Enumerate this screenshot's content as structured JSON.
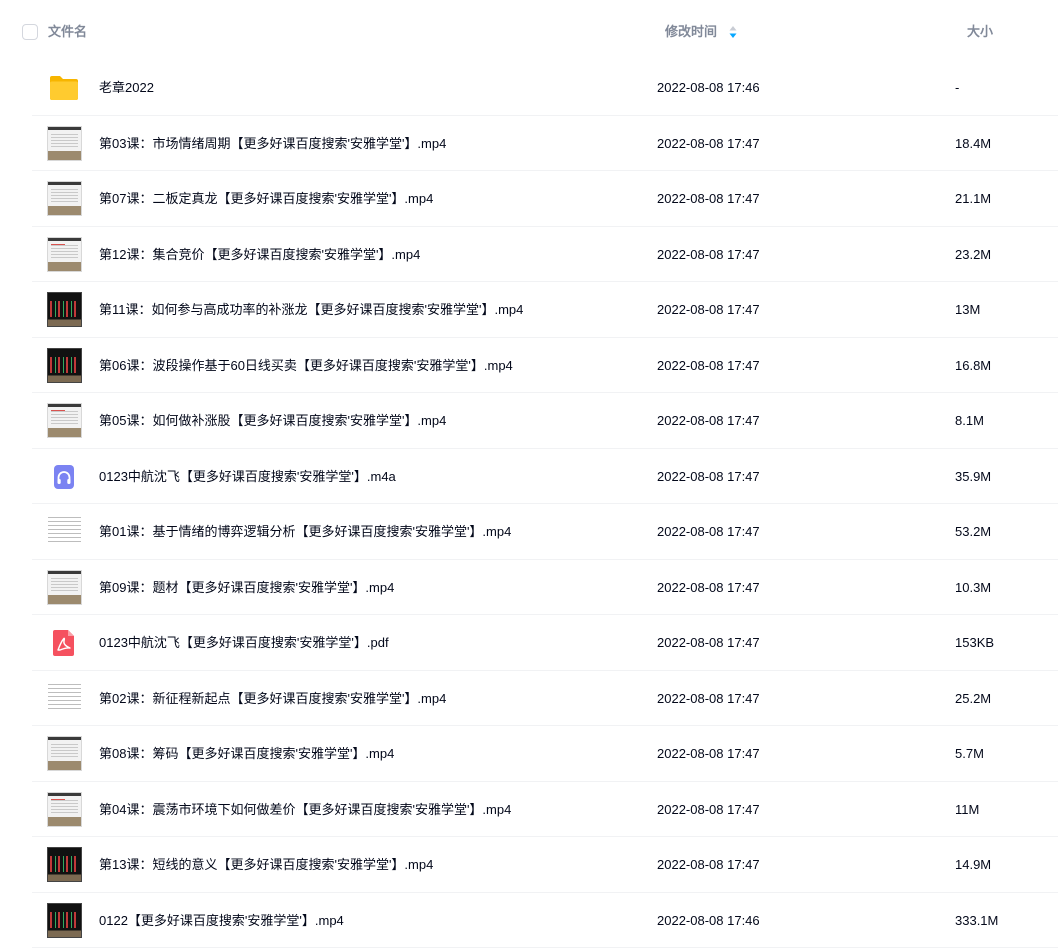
{
  "header": {
    "name_label": "文件名",
    "time_label": "修改时间",
    "size_label": "大小"
  },
  "files": [
    {
      "name": "老章2022",
      "time": "2022-08-08 17:46",
      "size": "-",
      "icon": "folder-icon"
    },
    {
      "name": "第03课：市场情绪周期【更多好课百度搜索'安雅学堂'】.mp4",
      "time": "2022-08-08 17:47",
      "size": "18.4M",
      "icon": "video-thumbnail"
    },
    {
      "name": "第07课：二板定真龙【更多好课百度搜索'安雅学堂'】.mp4",
      "time": "2022-08-08 17:47",
      "size": "21.1M",
      "icon": "video-thumbnail"
    },
    {
      "name": "第12课：集合竞价【更多好课百度搜索'安雅学堂'】.mp4",
      "time": "2022-08-08 17:47",
      "size": "23.2M",
      "icon": "video-thumbnail"
    },
    {
      "name": "第11课：如何参与高成功率的补涨龙【更多好课百度搜索'安雅学堂'】.mp4",
      "time": "2022-08-08 17:47",
      "size": "13M",
      "icon": "video-thumbnail"
    },
    {
      "name": "第06课：波段操作基于60日线买卖【更多好课百度搜索'安雅学堂'】.mp4",
      "time": "2022-08-08 17:47",
      "size": "16.8M",
      "icon": "video-thumbnail"
    },
    {
      "name": "第05课：如何做补涨股【更多好课百度搜索'安雅学堂'】.mp4",
      "time": "2022-08-08 17:47",
      "size": "8.1M",
      "icon": "video-thumbnail"
    },
    {
      "name": "0123中航沈飞【更多好课百度搜索'安雅学堂'】.m4a",
      "time": "2022-08-08 17:47",
      "size": "35.9M",
      "icon": "audio-icon"
    },
    {
      "name": "第01课：基于情绪的博弈逻辑分析【更多好课百度搜索'安雅学堂'】.mp4",
      "time": "2022-08-08 17:47",
      "size": "53.2M",
      "icon": "video-thumbnail"
    },
    {
      "name": "第09课：题材【更多好课百度搜索'安雅学堂'】.mp4",
      "time": "2022-08-08 17:47",
      "size": "10.3M",
      "icon": "video-thumbnail"
    },
    {
      "name": "0123中航沈飞【更多好课百度搜索'安雅学堂'】.pdf",
      "time": "2022-08-08 17:47",
      "size": "153KB",
      "icon": "pdf-icon"
    },
    {
      "name": "第02课：新征程新起点【更多好课百度搜索'安雅学堂'】.mp4",
      "time": "2022-08-08 17:47",
      "size": "25.2M",
      "icon": "video-thumbnail"
    },
    {
      "name": "第08课：筹码【更多好课百度搜索'安雅学堂'】.mp4",
      "time": "2022-08-08 17:47",
      "size": "5.7M",
      "icon": "video-thumbnail"
    },
    {
      "name": "第04课：震荡市环境下如何做差价【更多好课百度搜索'安雅学堂'】.mp4",
      "time": "2022-08-08 17:47",
      "size": "11M",
      "icon": "video-thumbnail"
    },
    {
      "name": "第13课：短线的意义【更多好课百度搜索'安雅学堂'】.mp4",
      "time": "2022-08-08 17:47",
      "size": "14.9M",
      "icon": "video-thumbnail"
    },
    {
      "name": "0122【更多好课百度搜索'安雅学堂'】.mp4",
      "time": "2022-08-08 17:46",
      "size": "333.1M",
      "icon": "video-thumbnail"
    }
  ],
  "colors": {
    "header_text": "#818999",
    "body_text": "#03081a",
    "sort_accent": "#06a7ff",
    "folder": "#ffc933",
    "audio": "#7b83f2",
    "pdf": "#f5515f"
  }
}
